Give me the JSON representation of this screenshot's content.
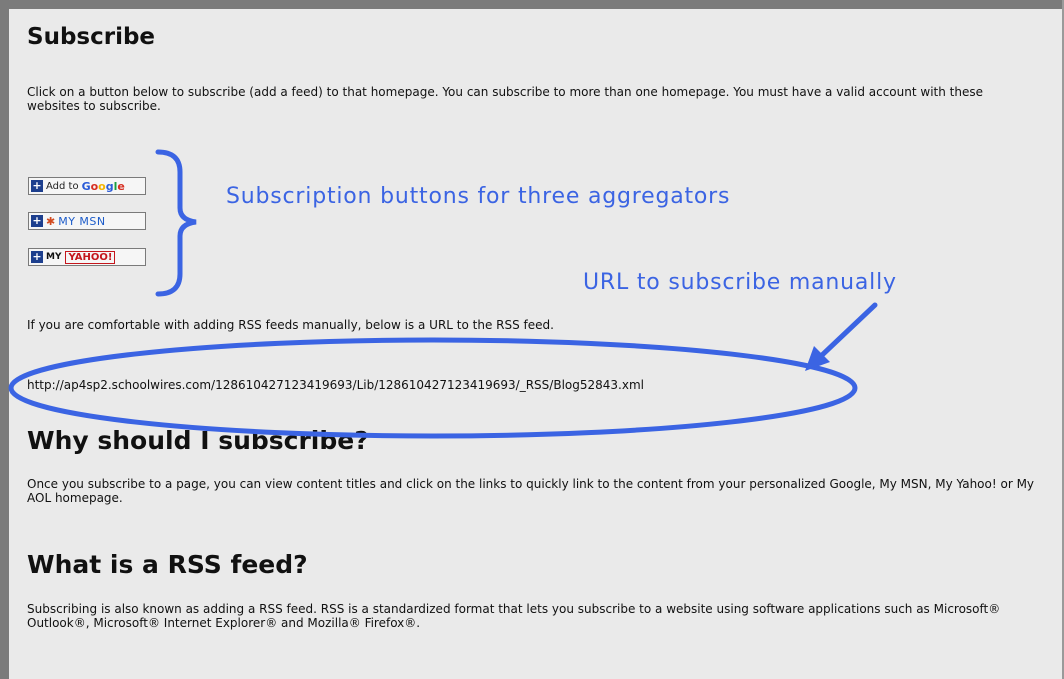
{
  "sections": {
    "subscribe": {
      "title": "Subscribe",
      "intro": "Click on a button below to subscribe (add a feed) to that homepage. You can subscribe to more than one homepage. You must have a valid account with these websites to subscribe."
    },
    "buttons": {
      "google": {
        "prefix": "Add to",
        "brand": "Google"
      },
      "msn": {
        "label": "MY MSN"
      },
      "yahoo": {
        "prefix": "MY",
        "brand": "YAHOO!"
      }
    },
    "manual": {
      "text": "If you are comfortable with adding RSS feeds manually, below is a URL to the RSS feed.",
      "url": "http://ap4sp2.schoolwires.com/128610427123419693/Lib/128610427123419693/_RSS/Blog52843.xml"
    },
    "why": {
      "title": "Why should I subscribe?",
      "text": "Once you subscribe to a page, you can view content titles and click on the links to quickly link to the content from your personalized Google, My MSN, My Yahoo! or My AOL homepage."
    },
    "what": {
      "title": "What is a RSS feed?",
      "text": "Subscribing is also known as adding a RSS feed. RSS is a standardized format that lets you subscribe to a website using software applications such as Microsoft® Outlook®, Microsoft® Internet Explorer® and Mozilla® Firefox®."
    }
  },
  "annotations": {
    "buttons_note": "Subscription buttons for three aggregators",
    "url_note": "URL to subscribe manually",
    "color": "#3b64e3"
  },
  "icons": {
    "plus": "plus-icon",
    "msn_butterfly": "msn-butterfly-icon"
  }
}
